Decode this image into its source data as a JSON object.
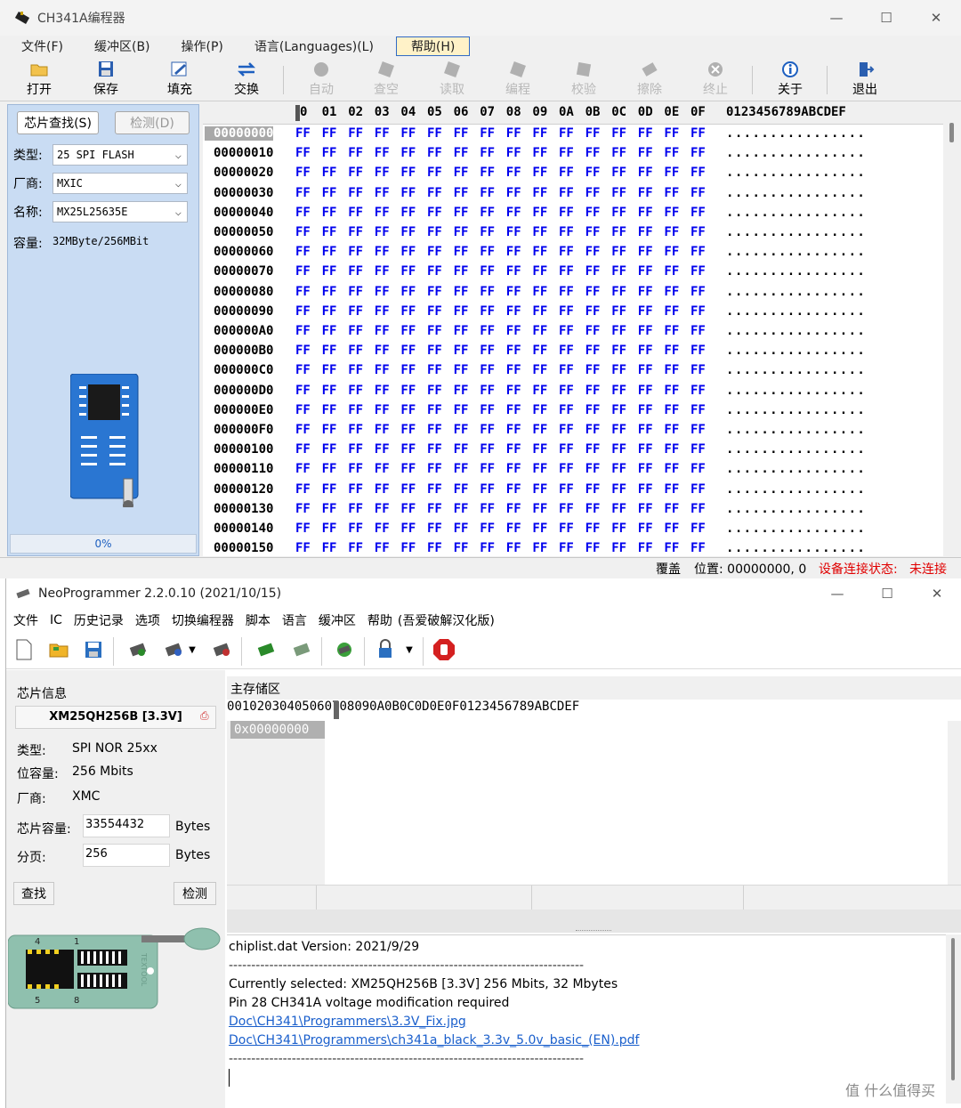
{
  "win1": {
    "title": "CH341A编程器",
    "menus": [
      "文件(F)",
      "缓冲区(B)",
      "操作(P)",
      "语言(Languages)(L)",
      "帮助(H)"
    ],
    "toolbar": [
      "打开",
      "保存",
      "填充",
      "交换",
      "自动",
      "查空",
      "读取",
      "编程",
      "校验",
      "擦除",
      "终止",
      "关于",
      "退出"
    ],
    "left": {
      "find_btn": "芯片查找(S)",
      "detect_btn": "检测(D)",
      "type_label": "类型:",
      "type_value": "25 SPI FLASH",
      "vendor_label": "厂商:",
      "vendor_value": "MXIC",
      "name_label": "名称:",
      "name_value": "MX25L25635E",
      "capacity_label": "容量:",
      "capacity_value": "32MByte/256MBit",
      "progress": "0%"
    },
    "hex": {
      "columns": [
        "0",
        "01",
        "02",
        "03",
        "04",
        "05",
        "06",
        "07",
        "08",
        "09",
        "0A",
        "0B",
        "0C",
        "0D",
        "0E",
        "0F"
      ],
      "ascii_header": "0123456789ABCDEF",
      "first_column_prefix": "0",
      "addresses": [
        "00000000",
        "00000010",
        "00000020",
        "00000030",
        "00000040",
        "00000050",
        "00000060",
        "00000070",
        "00000080",
        "00000090",
        "000000A0",
        "000000B0",
        "000000C0",
        "000000D0",
        "000000E0",
        "000000F0",
        "00000100",
        "00000110",
        "00000120",
        "00000130",
        "00000140",
        "00000150"
      ],
      "byte_value": "FF",
      "ascii_value": "................"
    },
    "status": {
      "mode": "覆盖",
      "position": "位置: 00000000, 0",
      "conn_label": "设备连接状态:",
      "conn_value": "未连接"
    }
  },
  "win2": {
    "title": "NeoProgrammer 2.2.0.10 (2021/10/15)",
    "menus": [
      "文件",
      "IC",
      "历史记录",
      "选项",
      "切换编程器",
      "脚本",
      "语言",
      "缓冲区",
      "帮助",
      "(吾爱破解汉化版)"
    ],
    "left": {
      "group_title": "芯片信息",
      "chip_name": "XM25QH256B [3.3V]",
      "type_label": "类型:",
      "type_value": "SPI NOR 25xx",
      "size_label": "位容量:",
      "size_value": "256 Mbits",
      "vendor_label": "厂商:",
      "vendor_value": "XMC",
      "chipsize_label": "芯片容量:",
      "chipsize_value": "33554432",
      "chipsize_unit": "Bytes",
      "page_label": "分页:",
      "page_value": "256",
      "page_unit": "Bytes",
      "find_btn": "查找",
      "detect_btn": "检测",
      "socket_pin_tl": "4",
      "socket_pin_tr": "1",
      "socket_pin_bl": "5",
      "socket_pin_br": "8",
      "socket_brand": "TEXTOOL"
    },
    "hex": {
      "tab": "主存储区",
      "columns": [
        "0",
        "01",
        "02",
        "03",
        "04",
        "05",
        "06",
        "07",
        "08",
        "09",
        "0A",
        "0B",
        "0C",
        "0D",
        "0E",
        "0F"
      ],
      "first_column_prefix": "0",
      "ascii_header": "0123456789ABCDEF",
      "first_address": "0x00000000"
    },
    "log": {
      "version": "chiplist.dat Version: 2021/9/29",
      "separator": "-------------------------------------------------------------------------------",
      "selected": "Currently selected: XM25QH256B [3.3V] 256 Mbits, 32 Mbytes",
      "note": "Pin 28 CH341A voltage modification required",
      "link1": "Doc\\CH341\\Programmers\\3.3V_Fix.jpg",
      "link2": "Doc\\CH341\\Programmers\\ch341a_black_3.3v_5.0v_basic_(EN).pdf"
    }
  },
  "watermark": "值 什么值得买"
}
